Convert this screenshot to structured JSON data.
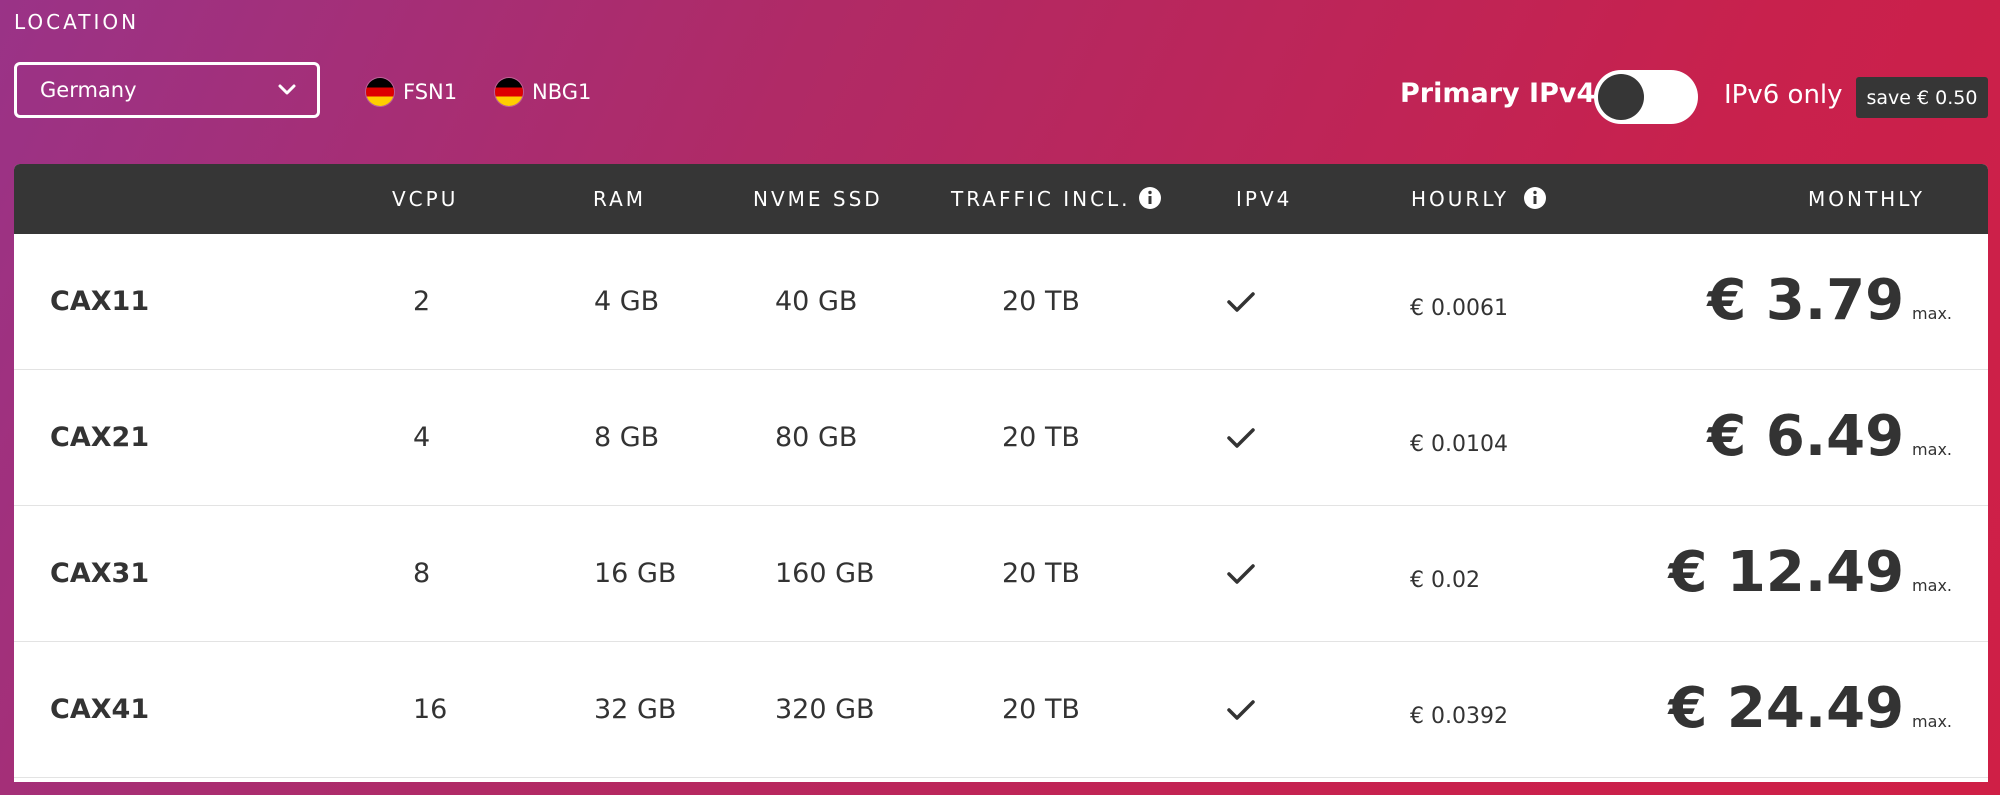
{
  "location": {
    "label": "LOCATION",
    "selected": "Germany",
    "datacenters": [
      {
        "name": "FSN1",
        "flag": "germany-flag"
      },
      {
        "name": "NBG1",
        "flag": "germany-flag"
      }
    ]
  },
  "ip_options": {
    "primary_label": "Primary IPv4",
    "toggle_on": false,
    "alt_label": "IPv6 only",
    "save_badge": "save € 0.50"
  },
  "table": {
    "headers": {
      "vcpu": "VCPU",
      "ram": "RAM",
      "ssd": "NVME SSD",
      "traffic": "TRAFFIC INCL.",
      "ipv4": "IPV4",
      "hourly": "HOURLY",
      "monthly": "MONTHLY"
    },
    "rows": [
      {
        "name": "CAX11",
        "vcpu": "2",
        "ram": "4 GB",
        "ssd": "40 GB",
        "traffic": "20 TB",
        "ipv4": true,
        "hourly": "€ 0.0061",
        "monthly": "€ 3.79",
        "max": "max."
      },
      {
        "name": "CAX21",
        "vcpu": "4",
        "ram": "8 GB",
        "ssd": "80 GB",
        "traffic": "20 TB",
        "ipv4": true,
        "hourly": "€ 0.0104",
        "monthly": "€ 6.49",
        "max": "max."
      },
      {
        "name": "CAX31",
        "vcpu": "8",
        "ram": "16 GB",
        "ssd": "160 GB",
        "traffic": "20 TB",
        "ipv4": true,
        "hourly": "€ 0.02",
        "monthly": "€ 12.49",
        "max": "max."
      },
      {
        "name": "CAX41",
        "vcpu": "16",
        "ram": "32 GB",
        "ssd": "320 GB",
        "traffic": "20 TB",
        "ipv4": true,
        "hourly": "€ 0.0392",
        "monthly": "€ 24.49",
        "max": "max."
      }
    ]
  },
  "colors": {
    "header_bg": "#363636",
    "text_dark": "#333333",
    "gradient_start": "#9a3387",
    "gradient_end": "#cf1f46"
  }
}
